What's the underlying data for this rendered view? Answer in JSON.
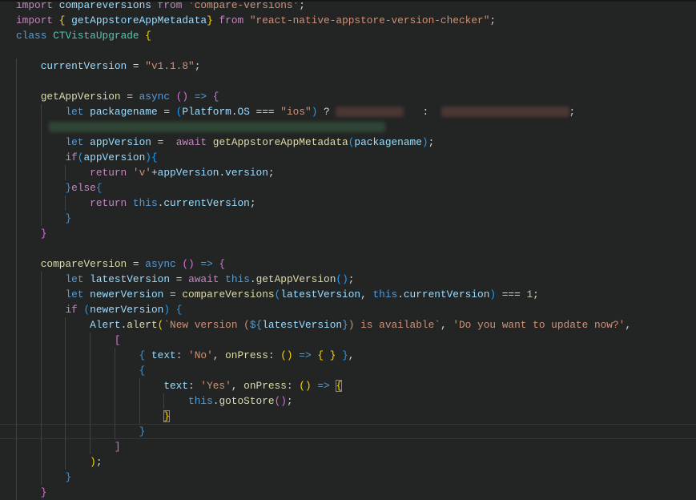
{
  "editor": {
    "theme_colors": {
      "background": "#232525",
      "keyword": "#c586c0",
      "storage": "#569cd6",
      "identifier": "#9cdcfe",
      "function": "#dcdcaa",
      "string": "#ce9178",
      "class": "#4ec9b0"
    },
    "current_line": 29,
    "lines": [
      [
        [
          "kw",
          "import"
        ],
        [
          "p",
          " "
        ],
        [
          "id",
          "compareVersions"
        ],
        [
          "p",
          " "
        ],
        [
          "kw",
          "from"
        ],
        [
          "p",
          " "
        ],
        [
          "str",
          "'compare-versions'"
        ],
        [
          "p",
          ";"
        ]
      ],
      [
        [
          "kw",
          "import"
        ],
        [
          "p",
          " "
        ],
        [
          "br",
          "{"
        ],
        [
          "p",
          " "
        ],
        [
          "id",
          "getAppstoreAppMetadata"
        ],
        [
          "br",
          "}"
        ],
        [
          "p",
          " "
        ],
        [
          "kw",
          "from"
        ],
        [
          "p",
          " "
        ],
        [
          "str",
          "\"react-native-appstore-version-checker\""
        ],
        [
          "p",
          ";"
        ]
      ],
      [
        [
          "st",
          "class"
        ],
        [
          "p",
          " "
        ],
        [
          "cls",
          "CTVistaUpgrade"
        ],
        [
          "p",
          " "
        ],
        [
          "br",
          "{"
        ]
      ],
      [],
      [
        [
          "p",
          "    "
        ],
        [
          "id",
          "currentVersion"
        ],
        [
          "p",
          " = "
        ],
        [
          "str",
          "\"v1.1.8\""
        ],
        [
          "p",
          ";"
        ]
      ],
      [],
      [
        [
          "p",
          "    "
        ],
        [
          "fn",
          "getAppVersion"
        ],
        [
          "p",
          " = "
        ],
        [
          "st",
          "async"
        ],
        [
          "p",
          " "
        ],
        [
          "br2",
          "()"
        ],
        [
          "p",
          " "
        ],
        [
          "st",
          "=>"
        ],
        [
          "p",
          " "
        ],
        [
          "br2",
          "{"
        ]
      ],
      [
        [
          "p",
          "        "
        ],
        [
          "st",
          "let"
        ],
        [
          "p",
          " "
        ],
        [
          "id",
          "packagename"
        ],
        [
          "p",
          " = "
        ],
        [
          "br3",
          "("
        ],
        [
          "id",
          "Platform"
        ],
        [
          "p",
          "."
        ],
        [
          "id",
          "OS"
        ],
        [
          "p",
          " === "
        ],
        [
          "str",
          "\"ios\""
        ],
        [
          "br3",
          ")"
        ],
        [
          "p",
          " ? "
        ],
        [
          "blur-a",
          ""
        ],
        [
          "p",
          "   :  "
        ],
        [
          "blur-b",
          ""
        ],
        [
          "p",
          ";"
        ]
      ],
      [
        [
          "p",
          "        "
        ],
        [
          "blur-c",
          ""
        ]
      ],
      [
        [
          "p",
          "        "
        ],
        [
          "st",
          "let"
        ],
        [
          "p",
          " "
        ],
        [
          "id",
          "appVersion"
        ],
        [
          "p",
          " =  "
        ],
        [
          "kw",
          "await"
        ],
        [
          "p",
          " "
        ],
        [
          "fn",
          "getAppstoreAppMetadata"
        ],
        [
          "br3",
          "("
        ],
        [
          "id",
          "packagename"
        ],
        [
          "br3",
          ")"
        ],
        [
          "p",
          ";"
        ]
      ],
      [
        [
          "p",
          "        "
        ],
        [
          "kw",
          "if"
        ],
        [
          "br3",
          "("
        ],
        [
          "id",
          "appVersion"
        ],
        [
          "br3",
          ")"
        ],
        [
          "br3",
          "{"
        ]
      ],
      [
        [
          "p",
          "            "
        ],
        [
          "kw",
          "return"
        ],
        [
          "p",
          " "
        ],
        [
          "str",
          "'v'"
        ],
        [
          "p",
          "+"
        ],
        [
          "id",
          "appVersion"
        ],
        [
          "p",
          "."
        ],
        [
          "id",
          "version"
        ],
        [
          "p",
          ";"
        ]
      ],
      [
        [
          "p",
          "        "
        ],
        [
          "br3",
          "}"
        ],
        [
          "kw",
          "else"
        ],
        [
          "br3",
          "{"
        ]
      ],
      [
        [
          "p",
          "            "
        ],
        [
          "kw",
          "return"
        ],
        [
          "p",
          " "
        ],
        [
          "st",
          "this"
        ],
        [
          "p",
          "."
        ],
        [
          "id",
          "currentVersion"
        ],
        [
          "p",
          ";"
        ]
      ],
      [
        [
          "p",
          "        "
        ],
        [
          "br3",
          "}"
        ]
      ],
      [
        [
          "p",
          "    "
        ],
        [
          "br2",
          "}"
        ]
      ],
      [],
      [
        [
          "p",
          "    "
        ],
        [
          "fn",
          "compareVersion"
        ],
        [
          "p",
          " = "
        ],
        [
          "st",
          "async"
        ],
        [
          "p",
          " "
        ],
        [
          "br2",
          "()"
        ],
        [
          "p",
          " "
        ],
        [
          "st",
          "=>"
        ],
        [
          "p",
          " "
        ],
        [
          "br2",
          "{"
        ]
      ],
      [
        [
          "p",
          "        "
        ],
        [
          "st",
          "let"
        ],
        [
          "p",
          " "
        ],
        [
          "id",
          "latestVersion"
        ],
        [
          "p",
          " = "
        ],
        [
          "kw",
          "await"
        ],
        [
          "p",
          " "
        ],
        [
          "st",
          "this"
        ],
        [
          "p",
          "."
        ],
        [
          "fn",
          "getAppVersion"
        ],
        [
          "br3",
          "()"
        ],
        [
          "p",
          ";"
        ]
      ],
      [
        [
          "p",
          "        "
        ],
        [
          "st",
          "let"
        ],
        [
          "p",
          " "
        ],
        [
          "id",
          "newerVersion"
        ],
        [
          "p",
          " = "
        ],
        [
          "fn",
          "compareVersions"
        ],
        [
          "br3",
          "("
        ],
        [
          "id",
          "latestVersion"
        ],
        [
          "p",
          ", "
        ],
        [
          "st",
          "this"
        ],
        [
          "p",
          "."
        ],
        [
          "id",
          "currentVersion"
        ],
        [
          "br3",
          ")"
        ],
        [
          "p",
          " === "
        ],
        [
          "num",
          "1"
        ],
        [
          "p",
          ";"
        ]
      ],
      [
        [
          "p",
          "        "
        ],
        [
          "kw",
          "if"
        ],
        [
          "p",
          " "
        ],
        [
          "br3",
          "("
        ],
        [
          "id",
          "newerVersion"
        ],
        [
          "br3",
          ")"
        ],
        [
          "p",
          " "
        ],
        [
          "br3",
          "{"
        ]
      ],
      [
        [
          "p",
          "            "
        ],
        [
          "id",
          "Alert"
        ],
        [
          "p",
          "."
        ],
        [
          "fn",
          "alert"
        ],
        [
          "br",
          "("
        ],
        [
          "str",
          "`New version ("
        ],
        [
          "st",
          "${"
        ],
        [
          "id",
          "latestVersion"
        ],
        [
          "st",
          "}"
        ],
        [
          "str",
          ") is available`"
        ],
        [
          "p",
          ", "
        ],
        [
          "str",
          "'Do you want to update now?'"
        ],
        [
          "p",
          ","
        ]
      ],
      [
        [
          "p",
          "                "
        ],
        [
          "br2",
          "["
        ]
      ],
      [
        [
          "p",
          "                    "
        ],
        [
          "br3",
          "{"
        ],
        [
          "p",
          " "
        ],
        [
          "id",
          "text"
        ],
        [
          "p",
          ": "
        ],
        [
          "str",
          "'No'"
        ],
        [
          "p",
          ", "
        ],
        [
          "fn",
          "onPress"
        ],
        [
          "p",
          ": "
        ],
        [
          "br",
          "()"
        ],
        [
          "p",
          " "
        ],
        [
          "st",
          "=>"
        ],
        [
          "p",
          " "
        ],
        [
          "br",
          "{"
        ],
        [
          "p",
          " "
        ],
        [
          "br",
          "}"
        ],
        [
          "p",
          " "
        ],
        [
          "br3",
          "}"
        ],
        [
          "p",
          ","
        ]
      ],
      [
        [
          "p",
          "                    "
        ],
        [
          "br3",
          "{"
        ]
      ],
      [
        [
          "p",
          "                        "
        ],
        [
          "id",
          "text"
        ],
        [
          "p",
          ": "
        ],
        [
          "str",
          "'Yes'"
        ],
        [
          "p",
          ", "
        ],
        [
          "fn",
          "onPress"
        ],
        [
          "p",
          ": "
        ],
        [
          "br",
          "()"
        ],
        [
          "p",
          " "
        ],
        [
          "st",
          "=>"
        ],
        [
          "p",
          " "
        ],
        [
          "br match",
          "{"
        ]
      ],
      [
        [
          "p",
          "                            "
        ],
        [
          "st",
          "this"
        ],
        [
          "p",
          "."
        ],
        [
          "fn",
          "gotoStore"
        ],
        [
          "br2",
          "()"
        ],
        [
          "p",
          ";"
        ]
      ],
      [
        [
          "p",
          "                        "
        ],
        [
          "br match",
          "}"
        ]
      ],
      [
        [
          "p",
          "                    "
        ],
        [
          "br3",
          "}"
        ]
      ],
      [
        [
          "p",
          "                "
        ],
        [
          "br2",
          "]"
        ]
      ],
      [
        [
          "p",
          "            "
        ],
        [
          "br",
          ")"
        ],
        [
          "p",
          ";"
        ]
      ],
      [
        [
          "p",
          "        "
        ],
        [
          "br3",
          "}"
        ]
      ],
      [
        [
          "p",
          "    "
        ],
        [
          "br2",
          "}"
        ]
      ]
    ]
  }
}
